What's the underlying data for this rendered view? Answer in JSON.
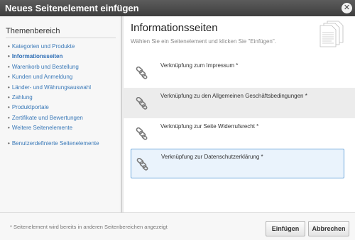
{
  "window": {
    "title": "Neues Seitenelement einfügen",
    "close_icon": "close-icon"
  },
  "sidebar": {
    "heading": "Themenbereich",
    "items": [
      {
        "label": "Kategorien und Produkte",
        "active": false
      },
      {
        "label": "Informationsseiten",
        "active": true
      },
      {
        "label": "Warenkorb und Bestellung",
        "active": false
      },
      {
        "label": "Kunden und Anmeldung",
        "active": false
      },
      {
        "label": "Länder- und Währungsauswahl",
        "active": false
      },
      {
        "label": "Zahlung",
        "active": false
      },
      {
        "label": "Produktportale",
        "active": false
      },
      {
        "label": "Zertifikate und Bewertungen",
        "active": false
      },
      {
        "label": "Weitere Seitenelemente",
        "active": false
      },
      {
        "label": "Benutzerdefinierte Seitenelemente",
        "active": false
      }
    ]
  },
  "main": {
    "title": "Informationsseiten",
    "subtitle": "Wählen Sie ein Seitenelement und klicken Sie \"Einfügen\".",
    "header_icon": "documents-icon",
    "elements": [
      {
        "label": "Verknüpfung zum Impressum *",
        "icon": "chain-link-icon"
      },
      {
        "label": "Verknüpfung zu den Allgemeinen Geschäftsbedingungen *",
        "icon": "chain-link-icon"
      },
      {
        "label": "Verknüpfung zur Seite Widerrufsrecht *",
        "icon": "chain-link-icon"
      },
      {
        "label": "Verknüpfung zur Datenschutzerklärung *",
        "icon": "chain-link-icon",
        "selected": true
      }
    ]
  },
  "footer": {
    "note": "* Seitenelement wird bereits in anderen Seitenbereichen angezeigt",
    "insert_label": "Einfügen",
    "cancel_label": "Abbrechen"
  },
  "colors": {
    "titlebar": "#4a4a4a",
    "link": "#3a79b8",
    "selected_border": "#6fa8dc",
    "selected_bg": "#eaf3fc"
  }
}
